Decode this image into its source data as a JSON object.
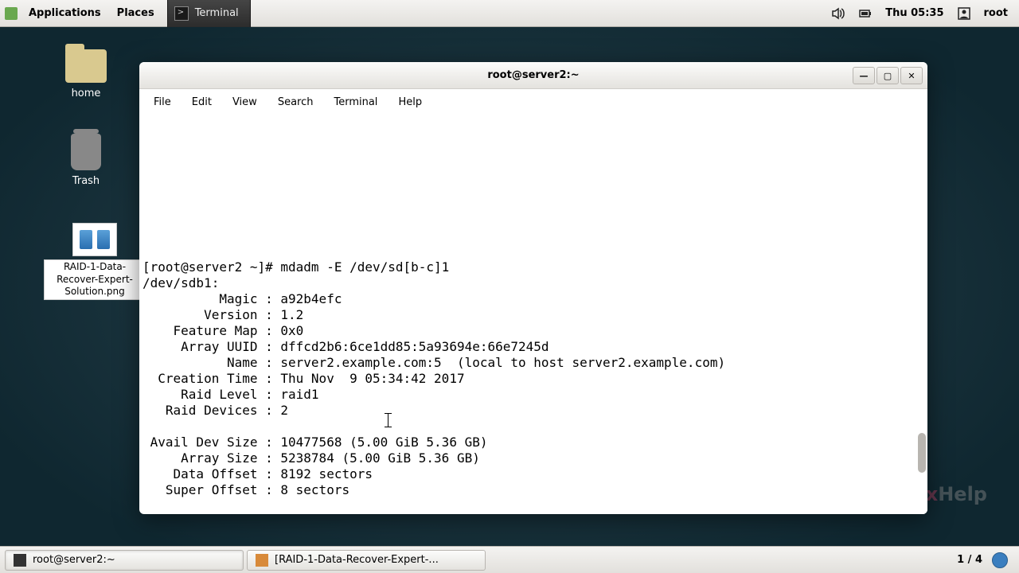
{
  "panel": {
    "applications": "Applications",
    "places": "Places",
    "running_app": "Terminal",
    "clock": "Thu 05:35",
    "user": "root"
  },
  "desktop": {
    "home": "home",
    "trash": "Trash",
    "file": "RAID-1-Data-Recover-Expert-Solution.png"
  },
  "window": {
    "title": "root@server2:~",
    "menu": {
      "file": "File",
      "edit": "Edit",
      "view": "View",
      "search": "Search",
      "terminal": "Terminal",
      "help": "Help"
    }
  },
  "terminal": {
    "prompt": "[root@server2 ~]# mdadm -E /dev/sd[b-c]1",
    "device": "/dev/sdb1:",
    "lines": {
      "magic": "          Magic : a92b4efc",
      "version": "        Version : 1.2",
      "feature_map": "    Feature Map : 0x0",
      "array_uuid": "     Array UUID : dffcd2b6:6ce1dd85:5a93694e:66e7245d",
      "name": "           Name : server2.example.com:5  (local to host server2.example.com)",
      "creation_time": "  Creation Time : Thu Nov  9 05:34:42 2017",
      "raid_level": "     Raid Level : raid1",
      "raid_devices": "   Raid Devices : 2",
      "blank": "",
      "avail_dev_size": " Avail Dev Size : 10477568 (5.00 GiB 5.36 GB)",
      "array_size": "     Array Size : 5238784 (5.00 GiB 5.36 GB)",
      "data_offset": "    Data Offset : 8192 sectors",
      "super_offset": "   Super Offset : 8 sectors"
    }
  },
  "taskbar": {
    "task1": "root@server2:~",
    "task2": "[RAID-1-Data-Recover-Expert-...",
    "pages": "1 / 4"
  },
  "watermark": {
    "a": "Linux",
    "b": "Help"
  }
}
